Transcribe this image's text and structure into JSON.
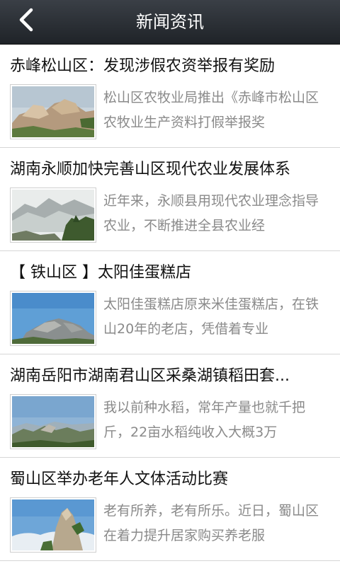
{
  "header": {
    "title": "新闻资讯",
    "back_icon": "chevron-left-icon"
  },
  "news": [
    {
      "title": "赤峰松山区：发现涉假农资举报有奖励",
      "summary": "松山区农牧业局推出《赤峰市松山区农牧业生产资料打假举报奖",
      "thumb": "rocky-peak-thumbnail"
    },
    {
      "title": "湖南永顺加快完善山区现代农业发展体系",
      "summary": "近年来，永顺县用现代农业理念指导农业，不断推进全县农业经",
      "thumb": "misty-mountain-thumbnail"
    },
    {
      "title": "【 铁山区 】太阳佳蛋糕店",
      "summary": "太阳佳蛋糕店原来米佳蛋糕店，在铁山20年的老店，凭借着专业",
      "thumb": "blue-sky-rock-thumbnail"
    },
    {
      "title": "湖南岳阳市湖南君山区采桑湖镇稻田套...",
      "summary": "我以前种水稻，常年产量也就千把斤，22亩水稻纯收入大概3万",
      "thumb": "mountain-range-thumbnail"
    },
    {
      "title": "蜀山区举办老年人文体活动比赛",
      "summary": "老有所养，老有所乐。近日，蜀山区在着力提升居家购买养老服",
      "thumb": "cloud-peak-thumbnail"
    }
  ]
}
